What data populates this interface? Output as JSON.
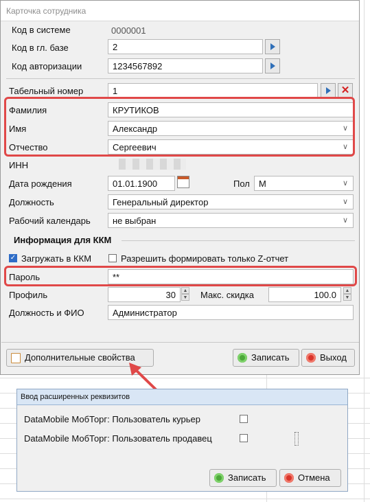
{
  "window": {
    "title": "Карточка сотрудника"
  },
  "fields": {
    "code_system": {
      "label": "Код в системе",
      "value": "0000001"
    },
    "code_main_base": {
      "label": "Код в гл. базе",
      "value": "2"
    },
    "auth_code": {
      "label": "Код авторизации",
      "value": "1234567892"
    },
    "tab_number": {
      "label": "Табельный номер",
      "value": "1"
    },
    "surname": {
      "label": "Фамилия",
      "value": "КРУТИКОВ"
    },
    "name": {
      "label": "Имя",
      "value": "Александр"
    },
    "patronymic": {
      "label": "Отчество",
      "value": "Сергеевич"
    },
    "inn": {
      "label": "ИНН"
    },
    "birth_date": {
      "label": "Дата рождения",
      "value": "01.01.1900"
    },
    "gender": {
      "label": "Пол",
      "value": "М"
    },
    "position": {
      "label": "Должность",
      "value": "Генеральный директор"
    },
    "work_calendar": {
      "label": "Рабочий календарь",
      "value": "не выбран"
    }
  },
  "kkm": {
    "section_title": "Информация для ККМ",
    "load_to_kkm": {
      "label": "Загружать в ККМ",
      "checked": true
    },
    "allow_z_report": {
      "label": "Разрешить формировать только Z-отчет",
      "checked": false
    },
    "password": {
      "label": "Пароль",
      "value": "**"
    },
    "profile": {
      "label": "Профиль",
      "value": "30"
    },
    "max_discount": {
      "label": "Макс. скидка",
      "value": "100.0"
    },
    "position_fio": {
      "label": "Должность и ФИО",
      "value": "Администратор"
    }
  },
  "buttons": {
    "extra_props": "Дополнительные свойства",
    "save": "Записать",
    "exit": "Выход"
  },
  "dialog": {
    "title": "Ввод расширенных реквизитов",
    "opt_courier": {
      "label": "DataMobile МобТорг: Пользователь курьер",
      "checked": false
    },
    "opt_seller": {
      "label": "DataMobile МобТорг: Пользователь продавец",
      "checked": false
    },
    "save": "Записать",
    "cancel": "Отмена"
  },
  "colors": {
    "highlight": "#e04848",
    "accent": "#2e6cc7"
  },
  "icons": {
    "picker": "triangle-right-icon",
    "delete": "red-x-icon",
    "dropdown": "chevron-down-icon",
    "calendar": "calendar-icon",
    "save": "ok-circle-icon",
    "exit": "exit-circle-icon",
    "extra_props": "document-icon"
  }
}
